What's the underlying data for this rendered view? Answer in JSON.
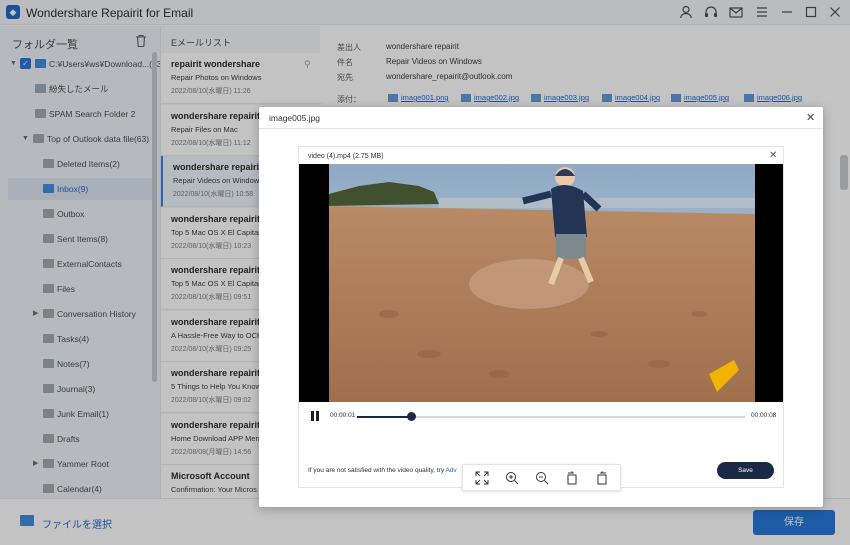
{
  "app": {
    "title": "Wondershare Repairit for Email"
  },
  "titlebar_icons": [
    "user-icon",
    "headset-icon",
    "mail-icon",
    "menu-icon",
    "minimize-icon",
    "maximize-icon",
    "close-icon"
  ],
  "sidebar": {
    "header": "フォルダ一覧",
    "root": "C:¥Users¥ws¥Download...(63)",
    "items": [
      {
        "label": "紛失したメール"
      },
      {
        "label": "SPAM Search Folder 2"
      },
      {
        "label": "Top of Outlook data file(63)"
      },
      {
        "label": "Deleted Items(2)"
      },
      {
        "label": "Inbox(9)"
      },
      {
        "label": "Outbox"
      },
      {
        "label": "Sent Items(8)"
      },
      {
        "label": "ExternalContacts"
      },
      {
        "label": "Files"
      },
      {
        "label": "Conversation History"
      },
      {
        "label": "Tasks(4)"
      },
      {
        "label": "Notes(7)"
      },
      {
        "label": "Journal(3)"
      },
      {
        "label": "Junk Email(1)"
      },
      {
        "label": "Drafts"
      },
      {
        "label": "Yammer Root"
      },
      {
        "label": "Calendar(4)"
      }
    ]
  },
  "maillist": {
    "header": "Eメールリスト",
    "items": [
      {
        "from": "repairit wondershare",
        "subject": "Repair Photos on Windows",
        "date": "2022/08/10(水曜日) 11:26"
      },
      {
        "from": "wondershare repairit",
        "subject": "Repair Files on Mac",
        "date": "2022/08/10(水曜日) 11:12"
      },
      {
        "from": "wondershare repairit",
        "subject": "Repair Videos on Windows",
        "date": "2022/08/10(水曜日) 10:58"
      },
      {
        "from": "wondershare repairit",
        "subject": "Top 5 Mac OS X El Capitan",
        "date": "2022/08/10(水曜日) 10:23"
      },
      {
        "from": "wondershare repairit",
        "subject": "Top 5 Mac OS X El Capitan",
        "date": "2022/08/10(水曜日) 09:51"
      },
      {
        "from": "wondershare repairit",
        "subject": "A Hassle-Free Way to OCR",
        "date": "2022/08/10(水曜日) 09:25"
      },
      {
        "from": "wondershare repairit",
        "subject": "5 Things to Help You Know",
        "date": "2022/08/10(水曜日) 09:02"
      },
      {
        "from": "wondershare repairit",
        "subject": "Home Download APP Men",
        "date": "2022/08/08(月曜日) 14:56"
      },
      {
        "from": "Microsoft Account",
        "subject": "Confirmation: Your Micros",
        "date": ""
      }
    ]
  },
  "detail": {
    "from_label": "差出人",
    "from": "wondershare repairit",
    "subject_label": "件名",
    "subject": "Repair Videos on Windows",
    "to_label": "宛先",
    "to": "wondershare_repairit@outlook.com",
    "attach_label": "添付：",
    "attachments": [
      "image001.png",
      "image002.jpg",
      "image003.jpg",
      "image004.jpg",
      "image005.jpg",
      "image006.jpg"
    ]
  },
  "bottom": {
    "pick_label": "ファイルを選択",
    "save_label": "保存"
  },
  "modal": {
    "title": "image005.jpg",
    "player": {
      "title": "video (4).mp4 (2.75  MB)",
      "time_current": "00:00:01",
      "time_total": "00:00:08",
      "progress": 0.14,
      "quality_text": "If you are not satisfied with the video quality, try",
      "quality_link": "Adv",
      "save_label": "Save"
    },
    "zoom_tools": [
      "fullscreen-icon",
      "zoom-in-icon",
      "zoom-out-icon",
      "rotate-left-icon",
      "rotate-right-icon"
    ]
  },
  "colors": {
    "accent": "#1b6fd9",
    "selected_row": "#d8e3f1",
    "player_dark": "#1a2a44"
  }
}
